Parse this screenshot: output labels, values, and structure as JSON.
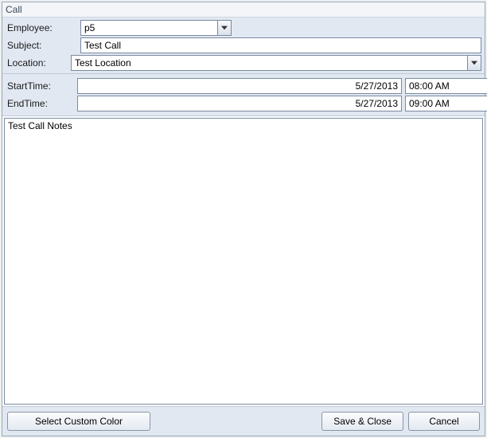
{
  "window": {
    "title": "Call"
  },
  "fields": {
    "employee_label": "Employee:",
    "employee_value": "p5",
    "subject_label": "Subject:",
    "subject_value": "Test Call",
    "location_label": "Location:",
    "location_value": "Test Location"
  },
  "times": {
    "start_label": "StartTime:",
    "start_date": "5/27/2013",
    "start_time": "08:00 AM",
    "end_label": "EndTime:",
    "end_date": "5/27/2013",
    "end_time": "09:00 AM"
  },
  "notes": {
    "value": "Test Call Notes"
  },
  "buttons": {
    "select_color": "Select Custom Color",
    "save_close": "Save & Close",
    "cancel": "Cancel"
  }
}
